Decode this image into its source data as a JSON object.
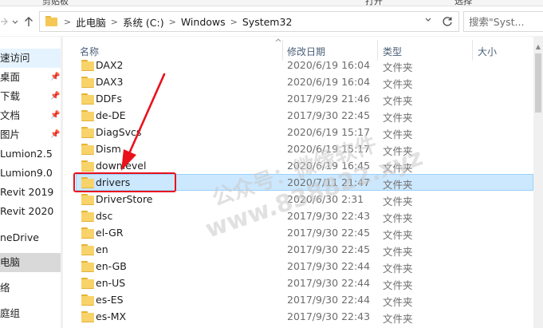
{
  "ribbon": {
    "partial_labels": [
      "剪贴板",
      "打开",
      "选择"
    ]
  },
  "navigation": {
    "back_icon": "back-arrow-icon",
    "forward_icon": "forward-arrow-icon",
    "recent_icon": "chevron-down-icon",
    "up_icon": "up-arrow-icon"
  },
  "address": {
    "crumbs": [
      "此电脑",
      "系统 (C:)",
      "Windows",
      "System32"
    ],
    "dropdown_icon": "chevron-down-icon",
    "refresh_icon": "refresh-icon"
  },
  "search": {
    "placeholder": "搜索\"Syst..."
  },
  "sidebar": {
    "items": [
      {
        "label": "速访问",
        "pinned": false
      },
      {
        "label": "桌面",
        "pinned": true
      },
      {
        "label": "下载",
        "pinned": true
      },
      {
        "label": "文档",
        "pinned": true
      },
      {
        "label": "图片",
        "pinned": true
      },
      {
        "label": "Lumion2.5",
        "pinned": false
      },
      {
        "label": "Lumion9.0",
        "pinned": false
      },
      {
        "label": "Revit 2019",
        "pinned": false
      },
      {
        "label": "Revit 2020",
        "pinned": false
      },
      {
        "label": "neDrive",
        "pinned": false
      },
      {
        "label": "电脑",
        "pinned": false
      },
      {
        "label": "络",
        "pinned": false
      },
      {
        "label": "庭组",
        "pinned": false
      }
    ]
  },
  "columns": {
    "name": "名称",
    "modified": "修改日期",
    "type": "类型",
    "size": "大小"
  },
  "files": [
    {
      "name": "DAX2",
      "modified": "2020/6/19 16:04",
      "type": "文件夹"
    },
    {
      "name": "DAX3",
      "modified": "2020/6/19 16:04",
      "type": "文件夹"
    },
    {
      "name": "DDFs",
      "modified": "2017/9/29 21:46",
      "type": "文件夹"
    },
    {
      "name": "de-DE",
      "modified": "2017/9/30 22:45",
      "type": "文件夹"
    },
    {
      "name": "DiagSvcs",
      "modified": "2020/6/19 15:17",
      "type": "文件夹"
    },
    {
      "name": "Dism",
      "modified": "2020/6/19 15:17",
      "type": "文件夹"
    },
    {
      "name": "downlevel",
      "modified": "2020/6/19 16:45",
      "type": "文件夹"
    },
    {
      "name": "drivers",
      "modified": "2020/7/11 21:47",
      "type": "文件夹"
    },
    {
      "name": "DriverStore",
      "modified": "2020/6/30 2:31",
      "type": "文件夹"
    },
    {
      "name": "dsc",
      "modified": "2017/9/30 22:43",
      "type": "文件夹"
    },
    {
      "name": "el-GR",
      "modified": "2017/9/30 22:45",
      "type": "文件夹"
    },
    {
      "name": "en",
      "modified": "2017/9/30 22:45",
      "type": "文件夹"
    },
    {
      "name": "en-GB",
      "modified": "2017/9/30 22:44",
      "type": "文件夹"
    },
    {
      "name": "en-US",
      "modified": "2017/9/30 22:44",
      "type": "文件夹"
    },
    {
      "name": "es-ES",
      "modified": "2017/9/30 22:44",
      "type": "文件夹"
    },
    {
      "name": "es-MX",
      "modified": "2017/9/30 22:43",
      "type": "文件夹"
    }
  ],
  "selected_file": "drivers",
  "annotation": {
    "highlight_color": "#e8111c"
  },
  "watermark": {
    "line1": "公众号：微缘软件",
    "line2": "www.838822.xyz"
  },
  "colors": {
    "selection_bg": "#cce8ff",
    "selection_border": "#99d1ff",
    "folder_yellow": "#f8d36a",
    "header_text": "#4c607a"
  }
}
